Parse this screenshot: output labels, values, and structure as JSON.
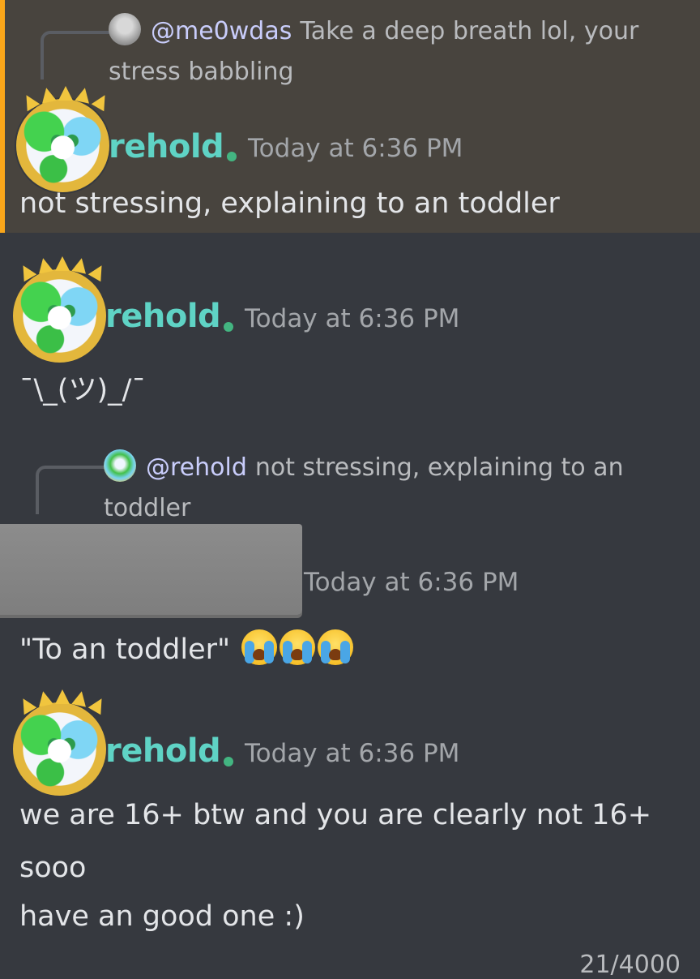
{
  "colors": {
    "background": "#36393f",
    "highlight_background": "#48443e",
    "highlight_border": "#faa61a",
    "author_color": "#5fd3c5",
    "online_dot": "#43b581"
  },
  "messages": [
    {
      "reply": {
        "mention": "@me0wdas",
        "text": "Take a deep breath lol, your",
        "text_line2": "stress babbling",
        "avatar_icon": "grey-avatar-icon"
      },
      "author": "rehold",
      "timestamp": "Today at 6:36 PM",
      "content": "not stressing, explaining to an toddler",
      "highlighted": true
    },
    {
      "author": "rehold",
      "timestamp": "Today at 6:36 PM",
      "content": "¯\\_(ツ)_/¯"
    },
    {
      "reply": {
        "mention": "@rehold",
        "text": "not stressing, explaining to an",
        "text_line2": "toddler",
        "avatar_icon": "rehold-avatar-icon"
      },
      "author": "[redacted]",
      "timestamp": "Today at 6:36 PM",
      "content": "\"To an toddler\"",
      "emoji": [
        "loudly-crying-face-icon",
        "loudly-crying-face-icon",
        "loudly-crying-face-icon"
      ]
    },
    {
      "author": "rehold",
      "timestamp": "Today at 6:36 PM",
      "lines": [
        "we are 16+ btw and you are clearly not 16+",
        "sooo",
        "have an good one :)"
      ]
    }
  ],
  "input": {
    "char_count": "21/4000"
  }
}
